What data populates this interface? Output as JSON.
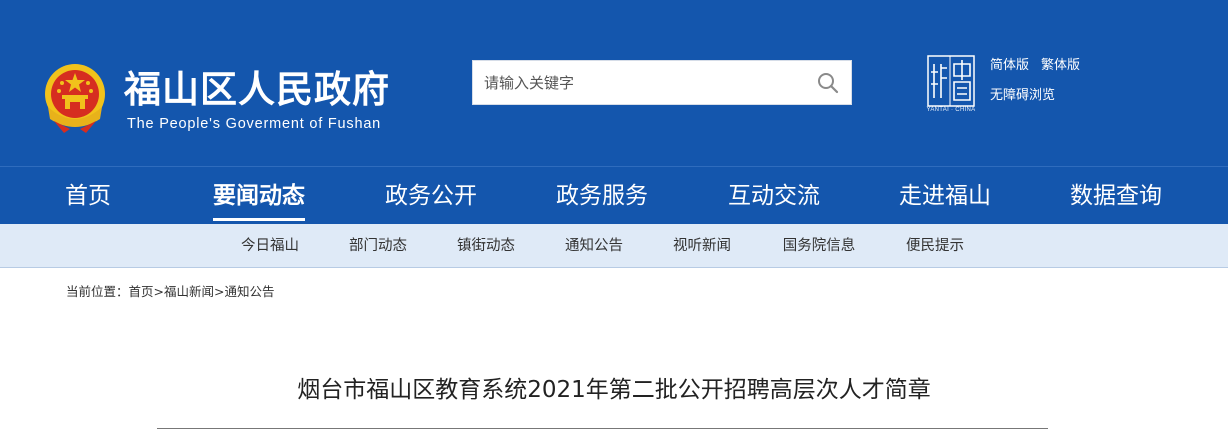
{
  "header": {
    "title": "福山区人民政府",
    "subtitle": "The People's Goverment of Fushan",
    "emblem_icon": "national-emblem-icon",
    "seal_icon": "yantai-china-seal-icon",
    "seal_caption": "YANTAI · CHINA",
    "background_color": "#1456ad"
  },
  "search": {
    "placeholder": "请输入关键字",
    "value": "",
    "icon": "search-icon"
  },
  "lang": {
    "simplified": "简体版",
    "traditional": "繁体版",
    "accessible": "无障碍浏览"
  },
  "main_nav": {
    "items": [
      {
        "label": "首页"
      },
      {
        "label": "要闻动态",
        "active": true
      },
      {
        "label": "政务公开"
      },
      {
        "label": "政务服务"
      },
      {
        "label": "互动交流"
      },
      {
        "label": "走进福山"
      },
      {
        "label": "数据查询"
      }
    ]
  },
  "sub_nav": {
    "items": [
      {
        "label": "今日福山"
      },
      {
        "label": "部门动态"
      },
      {
        "label": "镇街动态"
      },
      {
        "label": "通知公告"
      },
      {
        "label": "视听新闻"
      },
      {
        "label": "国务院信息"
      },
      {
        "label": "便民提示"
      }
    ],
    "background_color": "#dfeaf7"
  },
  "breadcrumb": {
    "prefix": "当前位置：",
    "items": [
      "首页",
      "福山新闻",
      "通知公告"
    ],
    "separator": ">"
  },
  "article": {
    "title": "烟台市福山区教育系统2021年第二批公开招聘高层次人才简章"
  }
}
